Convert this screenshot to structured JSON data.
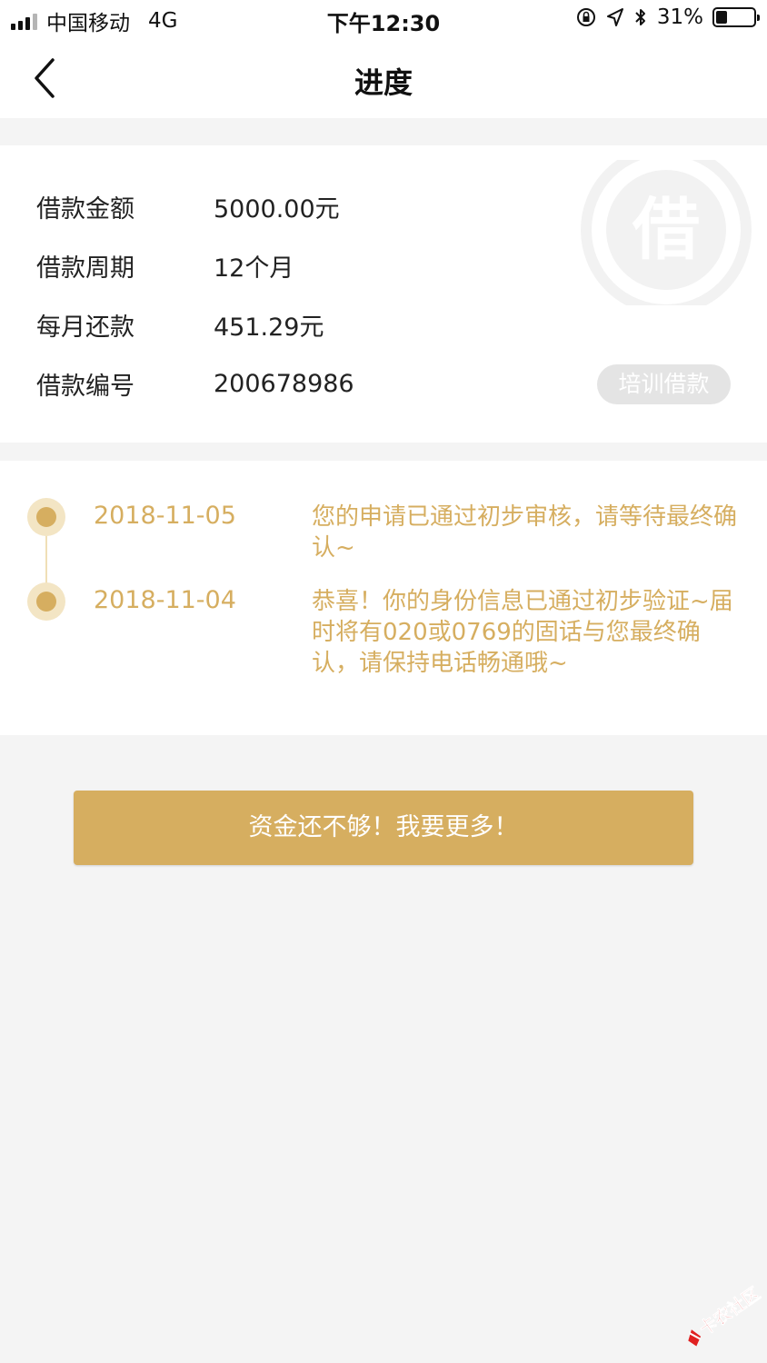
{
  "status_bar": {
    "carrier": "中国移动",
    "network": "4G",
    "time": "下午12:30",
    "battery": "31%",
    "battery_level": 0.31
  },
  "nav": {
    "title": "进度"
  },
  "loan_info": {
    "stamp_char": "借",
    "rows": [
      {
        "label": "借款金额",
        "value": "5000.00元"
      },
      {
        "label": "借款周期",
        "value": "12个月"
      },
      {
        "label": "每月还款",
        "value": "451.29元"
      },
      {
        "label": "借款编号",
        "value": "200678986"
      }
    ],
    "tag": "培训借款"
  },
  "timeline": [
    {
      "date": "2018-11-05",
      "message": "您的申请已通过初步审核，请等待最终确认~"
    },
    {
      "date": "2018-11-04",
      "message": "恭喜！你的身份信息已通过初步验证~届时将有020或0769的固话与您最终确认，请保持电话畅通哦~"
    }
  ],
  "cta": {
    "label": "资金还不够！我要更多！"
  },
  "watermark": {
    "text": "卡农社区"
  },
  "colors": {
    "accent": "#d6ae60",
    "accent_light": "#f3e5c4",
    "background": "#f4f4f4",
    "tag_bg": "#e4e4e4"
  }
}
